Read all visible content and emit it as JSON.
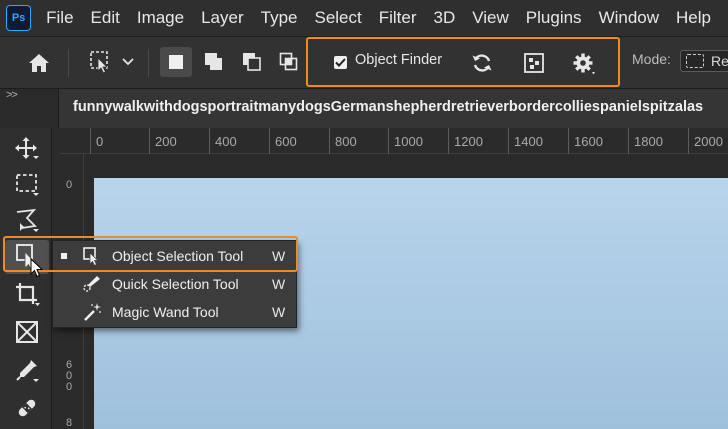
{
  "app": {
    "logo_text": "Ps"
  },
  "menu": [
    "File",
    "Edit",
    "Image",
    "Layer",
    "Type",
    "Select",
    "Filter",
    "3D",
    "View",
    "Plugins",
    "Window",
    "Help"
  ],
  "options_bar": {
    "object_finder_label": "Object Finder",
    "object_finder_checked": true,
    "mode_label": "Mode:",
    "mode_value": "Re"
  },
  "panel_collapse": ">>",
  "document": {
    "title": "funnywalkwithdogsportraitmanydogsGermanshepherdretrieverbordercolliespanielspitzalas"
  },
  "ruler_top_labels": [
    "0",
    "200",
    "400",
    "600",
    "800",
    "1000",
    "1200",
    "1400",
    "1600",
    "1800",
    "2000"
  ],
  "ruler_left_labels": [
    "0",
    "6",
    "0",
    "0",
    "8"
  ],
  "flyout": [
    {
      "label": "Object Selection Tool",
      "shortcut": "W",
      "active": true,
      "icon": "object-selection-icon"
    },
    {
      "label": "Quick Selection Tool",
      "shortcut": "W",
      "active": false,
      "icon": "quick-selection-icon"
    },
    {
      "label": "Magic Wand Tool",
      "shortcut": "W",
      "active": false,
      "icon": "magic-wand-icon"
    }
  ],
  "colors": {
    "accent": "#e98c29",
    "ps_blue": "#31a8ff"
  }
}
